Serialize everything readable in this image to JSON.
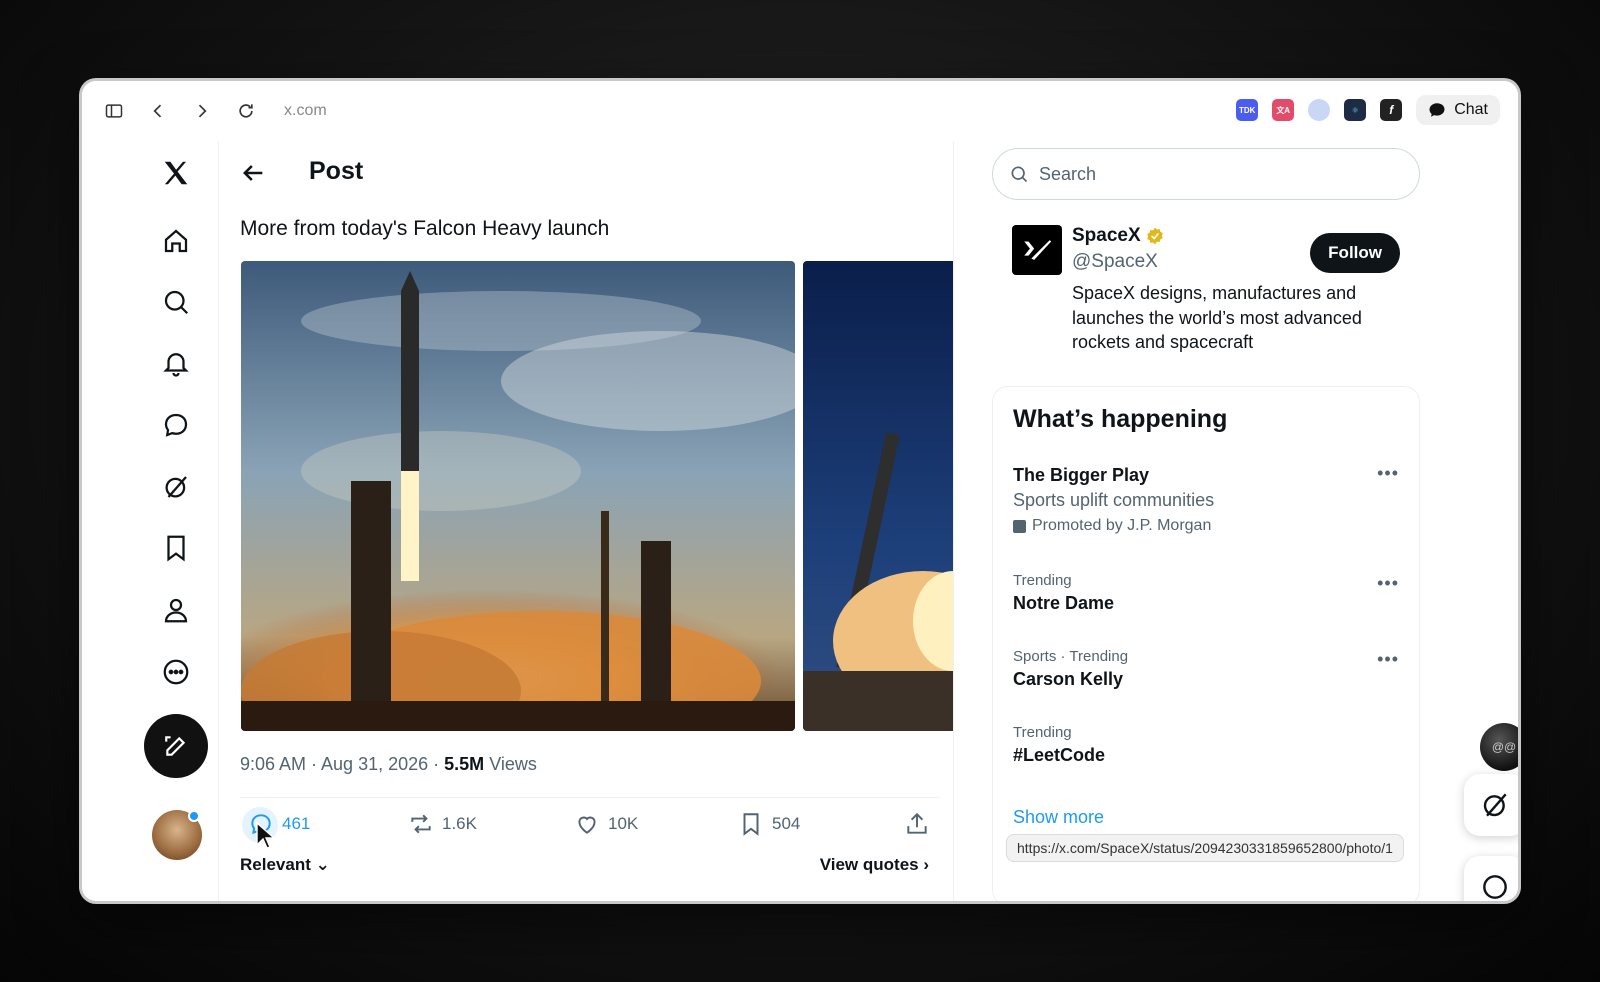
{
  "browser": {
    "url": "x.com",
    "chat_label": "Chat",
    "extensions": [
      "TDK",
      "translate",
      "privacy",
      "react",
      "fx"
    ]
  },
  "nav": {
    "items": [
      "home-icon",
      "search-icon",
      "bell-icon",
      "chat-bubble-icon",
      "grok-icon",
      "bookmark-icon",
      "profile-icon",
      "more-circle-icon"
    ],
    "compose_icon": "compose-icon"
  },
  "post": {
    "header_title": "Post",
    "text": "More from today's Falcon Heavy launch",
    "time": "9:06 AM · Aug 31, 2026 ·",
    "views_count": "5.5M",
    "views_label": "Views",
    "replies": "461",
    "reposts": "1.6K",
    "likes": "10K",
    "bookmarks": "504",
    "sort_label": "Relevant",
    "view_quotes": "View quotes"
  },
  "sidebar": {
    "search_placeholder": "Search",
    "profile": {
      "name": "SpaceX",
      "handle": "@SpaceX",
      "follow_label": "Follow",
      "bio": "SpaceX designs, manufactures and launches the world’s most advanced rockets and spacecraft"
    },
    "happening": {
      "title": "What’s happening",
      "items": [
        {
          "title": "The Bigger Play",
          "sub": "Sports uplift communities",
          "promo": "Promoted by J.P. Morgan"
        },
        {
          "context": "Trending",
          "title": "Notre Dame"
        },
        {
          "context": "Sports · Trending",
          "title": "Carson Kelly"
        },
        {
          "context": "Trending",
          "title": "#LeetCode"
        }
      ],
      "show_more": "Show more"
    }
  },
  "status_bar_url": "https://x.com/SpaceX/status/2094230331859652800/photo/1",
  "colors": {
    "accent": "#1d9bf0",
    "text": "#0f1419",
    "muted": "#536471",
    "verified_gold": "#e2b719"
  }
}
